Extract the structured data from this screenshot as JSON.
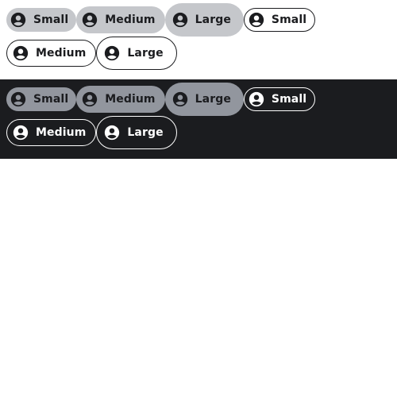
{
  "icon": "account-circle-icon",
  "colors": {
    "light_filled_bg": "#c5c7cb",
    "dark_bg": "#1b1c1f",
    "dark_filled_bg": "#92969e"
  },
  "light": {
    "filled": {
      "small": "Small",
      "medium": "Medium",
      "large": "Large"
    },
    "outlined": {
      "small": "Small",
      "medium": "Medium",
      "large": "Large"
    }
  },
  "dark": {
    "filled": {
      "small": "Small",
      "medium": "Medium",
      "large": "Large"
    },
    "outlined": {
      "small": "Small",
      "medium": "Medium",
      "large": "Large"
    }
  }
}
